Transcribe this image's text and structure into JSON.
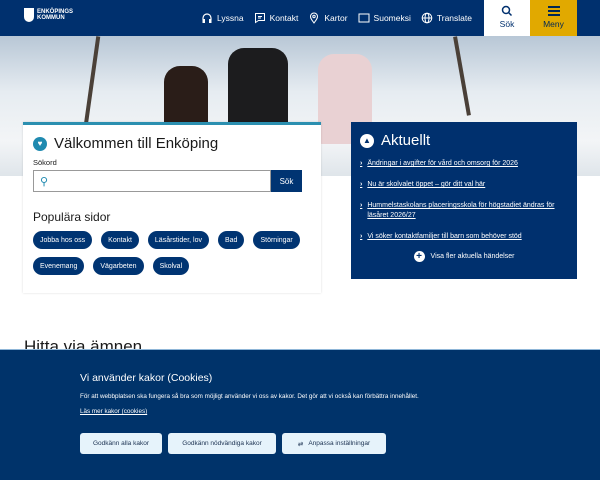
{
  "header": {
    "logo_text": [
      "ENKÖPINGS",
      "KOMMUN"
    ],
    "nav": [
      {
        "label": "Lyssna",
        "icon": "headphones-icon"
      },
      {
        "label": "Kontakt",
        "icon": "chat-icon"
      },
      {
        "label": "Kartor",
        "icon": "map-pin-icon"
      },
      {
        "label": "Suomeksi",
        "icon": "book-icon"
      },
      {
        "label": "Translate",
        "icon": "globe-icon"
      }
    ],
    "search_label": "Sök",
    "menu_label": "Meny"
  },
  "welcome": {
    "title": "Välkommen till Enköping",
    "search_label": "Sökord",
    "search_value": "",
    "search_button": "Sök",
    "popular_title": "Populära sidor",
    "tags": [
      "Jobba hos oss",
      "Kontakt",
      "Läsårstider, lov",
      "Bad",
      "Störningar",
      "Evenemang",
      "Vägarbeten",
      "Skolval"
    ]
  },
  "news": {
    "title": "Aktuellt",
    "items": [
      "Ändringar i avgifter för vård och omsorg för 2026",
      "Nu är skolvalet öppet – gör ditt val här",
      "Hummelstaskolans placeringsskola för högstadiet ändras för läsåret 2026/27",
      "Vi söker kontaktfamiljer till barn som behöver stöd"
    ],
    "more": "Visa fler aktuella händelser"
  },
  "section_title": "Hitta via ämnen",
  "cookie": {
    "title": "Vi använder kakor (Cookies)",
    "text": "För att webbplatsen ska fungera så bra som möjligt använder vi oss av kakor. Det gör att vi också kan förbättra innehållet.",
    "link": "Läs mer kakor (cookies)",
    "buttons": [
      "Godkänn alla kakor",
      "Godkänn nödvändiga kakor",
      "Anpassa inställningar"
    ]
  }
}
